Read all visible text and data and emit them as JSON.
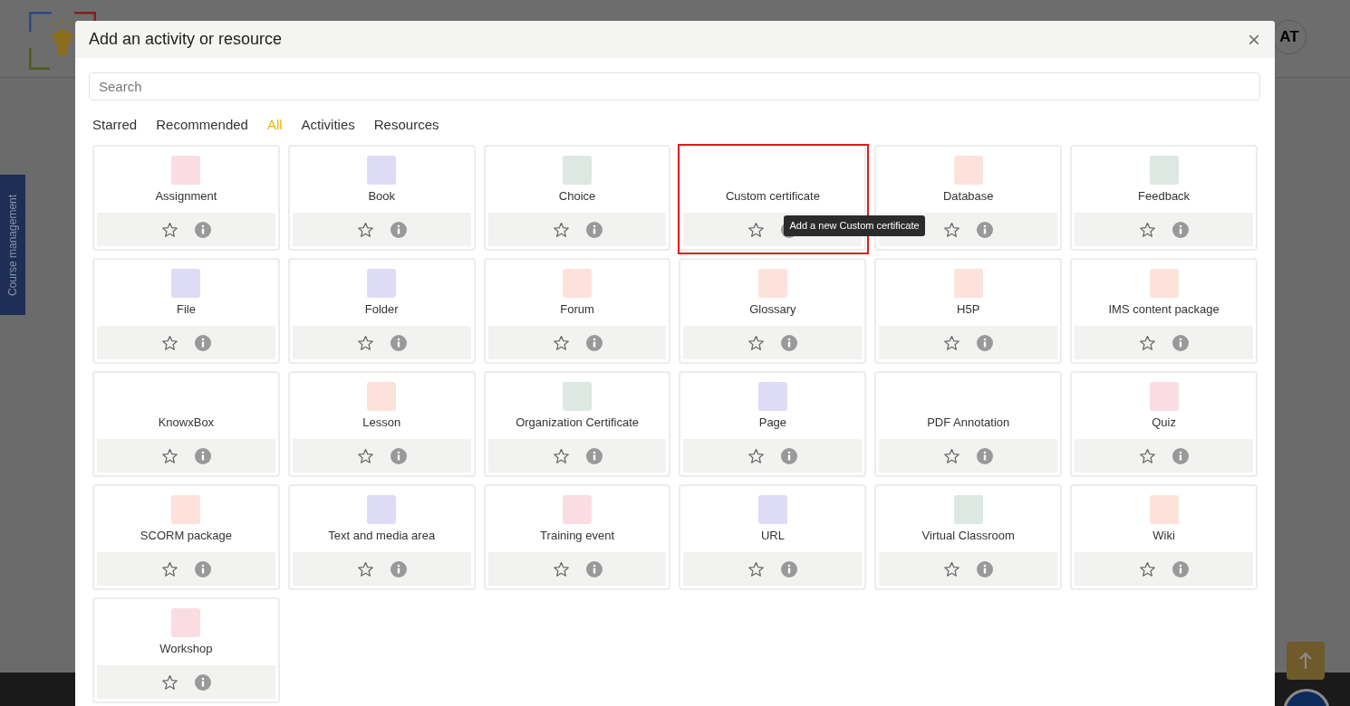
{
  "page": {
    "avatar": "AT",
    "side_tab": "Course management"
  },
  "dialog": {
    "title": "Add an activity or resource",
    "close": "×",
    "search": {
      "placeholder": "Search"
    },
    "tabs": [
      {
        "label": "Starred",
        "selected": false
      },
      {
        "label": "Recommended",
        "selected": false
      },
      {
        "label": "All",
        "selected": true
      },
      {
        "label": "Activities",
        "selected": false
      },
      {
        "label": "Resources",
        "selected": false
      }
    ],
    "items": [
      {
        "label": "Assignment",
        "color": "#fadde3",
        "highlighted": false
      },
      {
        "label": "Book",
        "color": "#dedbf6",
        "highlighted": false
      },
      {
        "label": "Choice",
        "color": "#dde8e3",
        "highlighted": false
      },
      {
        "label": "Custom certificate",
        "highlighted": true,
        "tooltip": "Add a new Custom certificate"
      },
      {
        "label": "Database",
        "color": "#fde2db",
        "highlighted": false
      },
      {
        "label": "Feedback",
        "color": "#dde8e3",
        "highlighted": false
      },
      {
        "label": "File",
        "color": "#dedbf6",
        "highlighted": false
      },
      {
        "label": "Folder",
        "color": "#dedbf6",
        "highlighted": false
      },
      {
        "label": "Forum",
        "color": "#fde2db",
        "highlighted": false
      },
      {
        "label": "Glossary",
        "color": "#fde2db",
        "highlighted": false
      },
      {
        "label": "H5P",
        "color": "#fde2db",
        "highlighted": false
      },
      {
        "label": "IMS content package",
        "color": "#fde2db",
        "highlighted": false
      },
      {
        "label": "KnowxBox",
        "highlighted": false
      },
      {
        "label": "Lesson",
        "color": "#fde2db",
        "highlighted": false
      },
      {
        "label": "Organization Certificate",
        "color": "#dde8e3",
        "highlighted": false
      },
      {
        "label": "Page",
        "color": "#dedbf6",
        "highlighted": false
      },
      {
        "label": "PDF Annotation",
        "highlighted": false
      },
      {
        "label": "Quiz",
        "color": "#fadde3",
        "highlighted": false
      },
      {
        "label": "SCORM package",
        "color": "#fde2db",
        "highlighted": false
      },
      {
        "label": "Text and media area",
        "color": "#dedbf6",
        "highlighted": false
      },
      {
        "label": "Training event",
        "color": "#fadde3",
        "highlighted": false
      },
      {
        "label": "URL",
        "color": "#dedbf6",
        "highlighted": false
      },
      {
        "label": "Virtual Classroom",
        "color": "#dde8e3",
        "highlighted": false
      },
      {
        "label": "Wiki",
        "color": "#fde2db",
        "highlighted": false
      },
      {
        "label": "Workshop",
        "color": "#fadde3",
        "highlighted": false
      }
    ]
  }
}
